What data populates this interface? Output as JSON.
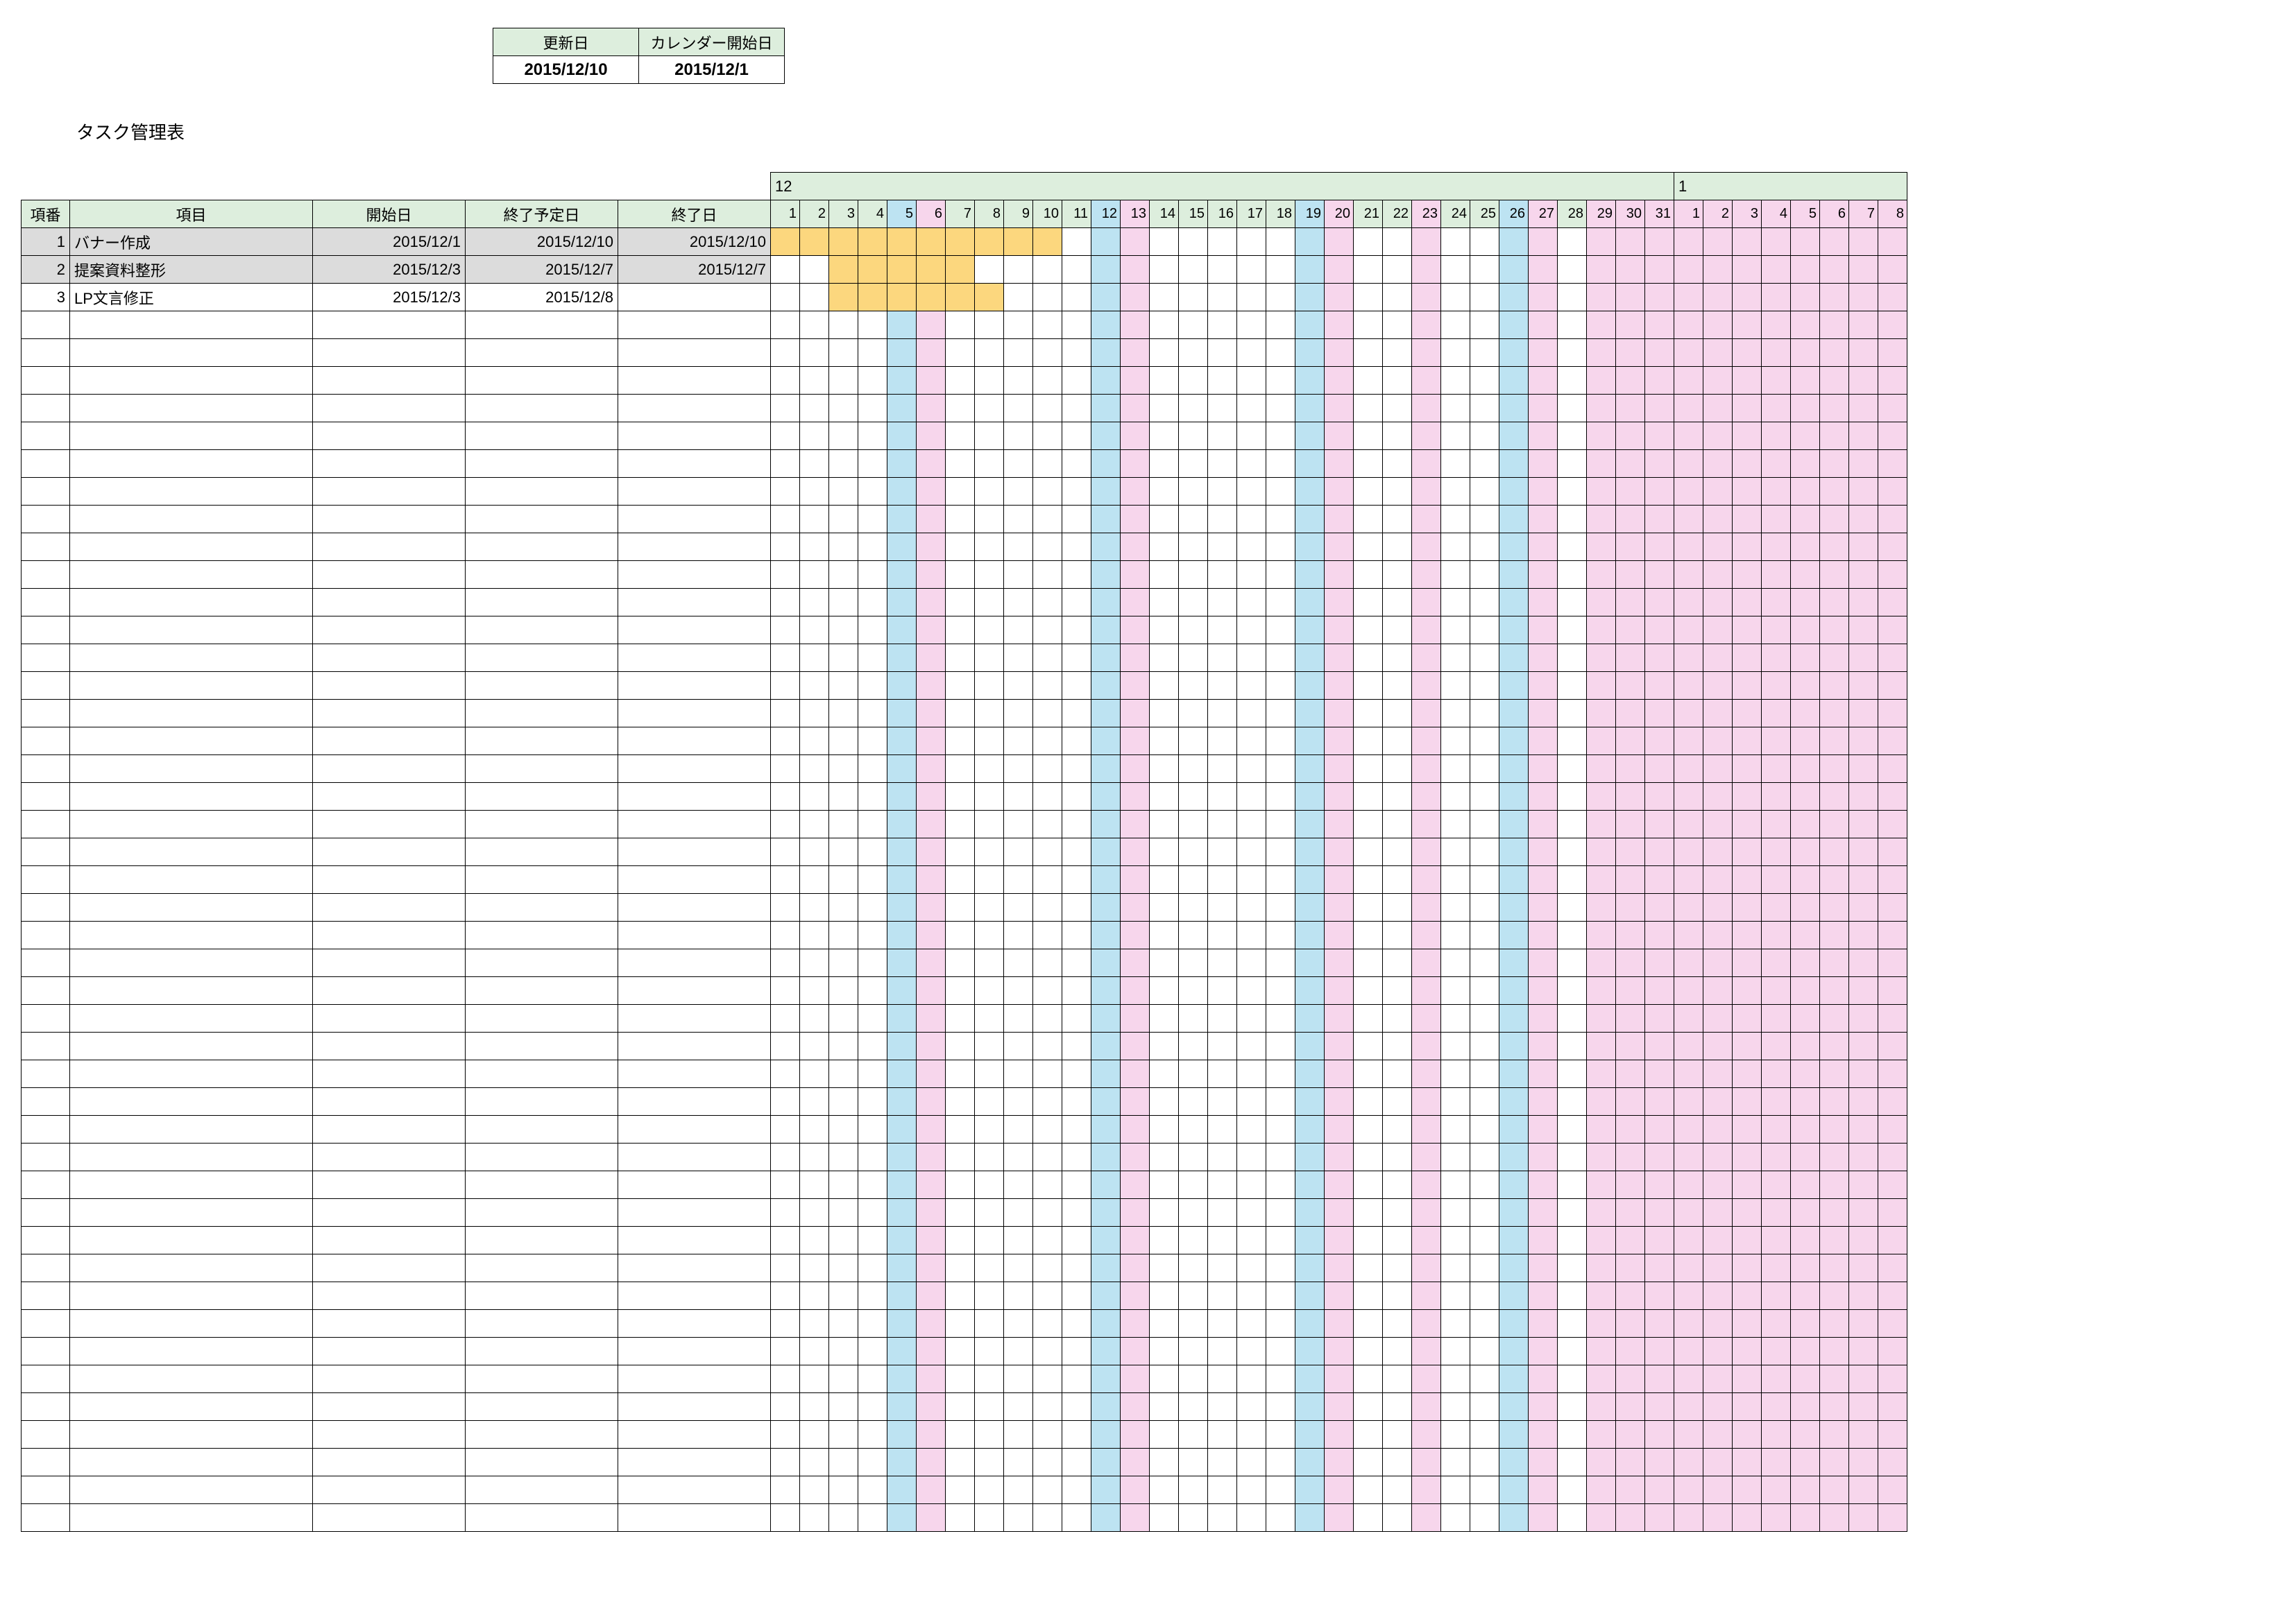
{
  "header": {
    "update_label": "更新日",
    "calstart_label": "カレンダー開始日",
    "update_value": "2015/12/10",
    "calstart_value": "2015/12/1"
  },
  "title": "タスク管理表",
  "columns": {
    "num": "項番",
    "item": "項目",
    "start": "開始日",
    "due": "終了予定日",
    "end": "終了日"
  },
  "calendar": {
    "months": [
      {
        "label": "12",
        "days": 31
      },
      {
        "label": "1",
        "days": 8
      }
    ],
    "days_dec": [
      1,
      2,
      3,
      4,
      5,
      6,
      7,
      8,
      9,
      10,
      11,
      12,
      13,
      14,
      15,
      16,
      17,
      18,
      19,
      20,
      21,
      22,
      23,
      24,
      25,
      26,
      27,
      28,
      29,
      30,
      31
    ],
    "days_jan": [
      1,
      2,
      3,
      4,
      5,
      6,
      7,
      8
    ],
    "saturdays": [
      5,
      12,
      19,
      26
    ],
    "sundays_holidays_dec": [
      6,
      13,
      20,
      23,
      27,
      29,
      30,
      31
    ],
    "sundays_holidays_jan": [
      1,
      2,
      3,
      4,
      5,
      6,
      7,
      8
    ]
  },
  "tasks": [
    {
      "num": 1,
      "item": "バナー作成",
      "start": "2015/12/1",
      "due": "2015/12/10",
      "end": "2015/12/10",
      "done": true,
      "bar_from": 1,
      "bar_to": 10
    },
    {
      "num": 2,
      "item": "提案資料整形",
      "start": "2015/12/3",
      "due": "2015/12/7",
      "end": "2015/12/7",
      "done": true,
      "bar_from": 3,
      "bar_to": 7
    },
    {
      "num": 3,
      "item": "LP文言修正",
      "start": "2015/12/3",
      "due": "2015/12/8",
      "end": "",
      "done": false,
      "bar_from": 3,
      "bar_to": 8
    }
  ],
  "blank_rows": 44
}
